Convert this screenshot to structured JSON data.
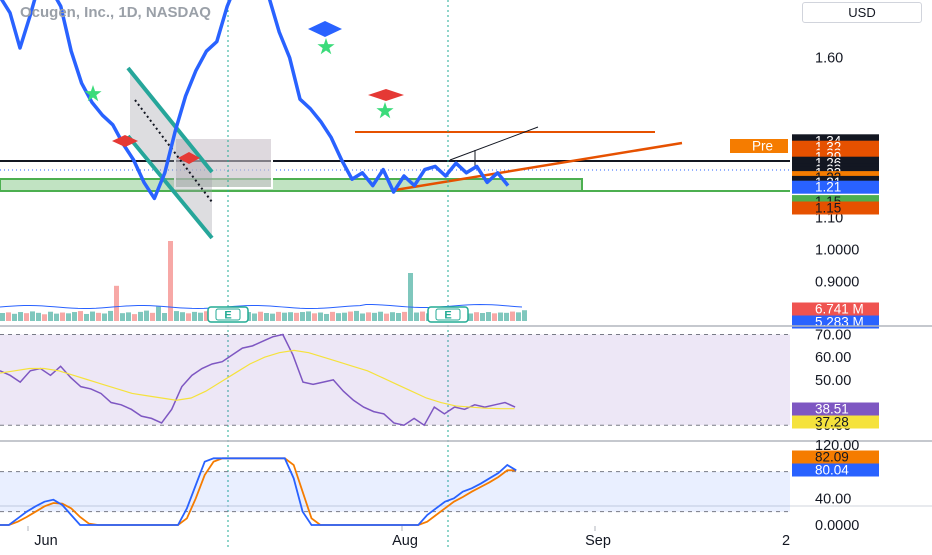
{
  "header": {
    "symbol_title": "Ocugen, Inc., 1D, NASDAQ",
    "currency_button": "USD"
  },
  "colors": {
    "price_line": "#2962ff",
    "rsi_line": "#7e57c2",
    "rsi_ma": "#f5e23c",
    "stoch_k": "#2962ff",
    "stoch_d": "#f57c00",
    "trend_orange": "#e65100",
    "channel_green": "#26a69a",
    "zone_green": "#4caf50",
    "earnings": "#22ab94"
  },
  "chart_data": [
    {
      "type": "line",
      "name": "price-pane",
      "title": "Ocugen, Inc., 1D, NASDAQ",
      "x_ticks": [
        "Jun",
        "Aug",
        "Sep",
        "2"
      ],
      "ylim": [
        0.78,
        1.78
      ],
      "y_tick_labels": [
        {
          "label": "1.60",
          "value": 1.6
        },
        {
          "label": "1.10",
          "value": 1.1
        },
        {
          "label": "1.0000",
          "value": 1.0
        },
        {
          "label": "0.9000",
          "value": 0.9
        }
      ],
      "series": [
        {
          "values": [
            1.8,
            1.74,
            1.63,
            1.73,
            1.84,
            1.82,
            1.76,
            1.62,
            1.52,
            1.46,
            1.42,
            1.39,
            1.33,
            1.28,
            1.21,
            1.16,
            1.24,
            1.37,
            1.48,
            1.56,
            1.62,
            1.65,
            1.76,
            1.84,
            1.86,
            1.84,
            1.79,
            1.68,
            1.6,
            1.47,
            1.44,
            1.4,
            1.35,
            1.28,
            1.22,
            1.24,
            1.2,
            1.25,
            1.18,
            1.23,
            1.2,
            1.25,
            1.26,
            1.23,
            1.27,
            1.24,
            1.26,
            1.21,
            1.24,
            1.2
          ]
        }
      ],
      "price_tags": [
        {
          "label": "1.34",
          "value": 1.34,
          "bg": "#131722",
          "fg": "#ffffff"
        },
        {
          "label": "1.32",
          "value": 1.32,
          "bg": "#e65100",
          "fg": "#ffffff"
        },
        {
          "label": "1.32",
          "value": 1.3,
          "bg": "#e65100",
          "fg": "#ffffff"
        },
        {
          "label": "1.29",
          "value": 1.29,
          "bg": "#e65100",
          "fg": "#ffffff"
        },
        {
          "label": "1.26",
          "value": 1.27,
          "bg": "#131722",
          "fg": "#ffffff"
        },
        {
          "label": "1.23",
          "value": 1.25,
          "bg": "#131722",
          "fg": "#ffffff"
        },
        {
          "label": "1.23",
          "value": 1.24,
          "bg": "#131722",
          "fg": "#ffffff"
        },
        {
          "label": "1.22",
          "value": 1.225,
          "bg": "#f57c00",
          "fg": "#131722"
        },
        {
          "label": "1.21",
          "value": 1.21,
          "bg": "#131722",
          "fg": "#ffffff"
        },
        {
          "label": "1.21",
          "value": 1.195,
          "bg": "#2962ff",
          "fg": "#ffffff"
        },
        {
          "label": "1.15",
          "value": 1.15,
          "bg": "#4caf50",
          "fg": "#131722"
        },
        {
          "label": "1.15",
          "value": 1.13,
          "bg": "#e65100",
          "fg": "#131722"
        }
      ],
      "pre_market_label": "Pre",
      "volume_tags": [
        {
          "label": "6.741 M",
          "bg": "#ef5350"
        },
        {
          "label": "5.283 M",
          "bg": "#2962ff"
        }
      ],
      "volume": [
        5.0,
        5.4,
        4.5,
        5.6,
        4.9,
        6.0,
        5.1,
        4.2,
        5.8,
        4.6,
        5.3,
        4.8,
        5.6,
        6.2,
        4.4,
        5.9,
        5.1,
        4.7,
        6.3,
        22.0,
        4.9,
        5.4,
        4.3,
        5.7,
        6.5,
        5.1,
        9.0,
        5.0,
        50.0,
        6.2,
        5.5,
        4.8,
        5.7,
        5.2,
        6.1,
        4.6,
        5.3,
        5.9,
        4.9,
        5.4,
        4.5,
        5.6,
        4.7,
        5.8,
        5.0,
        4.6,
        5.7,
        5.2,
        5.5,
        5.1,
        5.6,
        6.0,
        4.8,
        5.3,
        4.4,
        5.7,
        4.9,
        5.2,
        5.9,
        6.3,
        4.7,
        5.4,
        5.1,
        5.8,
        4.6,
        5.5,
        5.0,
        5.7,
        30.0,
        5.3,
        5.9,
        4.8,
        5.6,
        5.1,
        5.4,
        4.9,
        5.8,
        5.2,
        4.7,
        5.5,
        5.0,
        5.6,
        4.8,
        5.3,
        5.1,
        5.9,
        5.4,
        6.741
      ]
    },
    {
      "type": "line",
      "name": "rsi-pane",
      "ylim": [
        27,
        72
      ],
      "y_tick_labels": [
        {
          "label": "70.00",
          "value": 70
        },
        {
          "label": "60.00",
          "value": 60
        },
        {
          "label": "50.00",
          "value": 50
        },
        {
          "label": "30.00",
          "value": 30
        }
      ],
      "band": [
        30,
        70
      ],
      "series": [
        {
          "name": "RSI",
          "color": "#7e57c2",
          "values": [
            54,
            52,
            49,
            54,
            55,
            52,
            56,
            51,
            47,
            46,
            44,
            40,
            39,
            37,
            34,
            33,
            31,
            37,
            47,
            52,
            55,
            57,
            58,
            61,
            64,
            65,
            67,
            69,
            70,
            61,
            49,
            48,
            49,
            50,
            45,
            41,
            38,
            36,
            35,
            31,
            30,
            33,
            30,
            38,
            35,
            38,
            37,
            39,
            38,
            39,
            40,
            38
          ]
        },
        {
          "name": "RSI MA",
          "color": "#f5e23c",
          "values": [
            53,
            54,
            55,
            55,
            54,
            52,
            50,
            48,
            46,
            44,
            43,
            42,
            41,
            42,
            45,
            49,
            53,
            57,
            60,
            62,
            63,
            62,
            60,
            58,
            56,
            54,
            51,
            48,
            45,
            42,
            40,
            38.5,
            38,
            37.5,
            37.3,
            37.28
          ]
        }
      ],
      "value_tags": [
        {
          "label": "38.51",
          "bg": "#7e57c2",
          "fg": "#ffffff"
        },
        {
          "label": "37.28",
          "bg": "#f5e23c",
          "fg": "#131722"
        }
      ]
    },
    {
      "type": "line",
      "name": "stoch-pane",
      "ylim": [
        0,
        120
      ],
      "y_tick_labels": [
        {
          "label": "120.00",
          "value": 120
        },
        {
          "label": "40.00",
          "value": 40
        },
        {
          "label": "0.0000",
          "value": 0
        }
      ],
      "band": [
        20,
        80
      ],
      "series": [
        {
          "name": "K",
          "color": "#2962ff",
          "values": [
            0,
            0,
            10,
            20,
            28,
            35,
            38,
            30,
            15,
            0,
            0,
            0,
            0,
            0,
            0,
            0,
            0,
            0,
            0,
            0,
            0,
            25,
            60,
            95,
            100,
            100,
            100,
            100,
            100,
            100,
            100,
            100,
            100,
            70,
            20,
            0,
            0,
            0,
            0,
            0,
            0,
            0,
            0,
            0,
            0,
            0,
            0,
            0,
            15,
            25,
            35,
            40,
            50,
            55,
            62,
            70,
            78,
            90,
            82
          ]
        },
        {
          "name": "D",
          "color": "#f57c00",
          "values": [
            0,
            0,
            5,
            12,
            20,
            28,
            33,
            32,
            25,
            12,
            2,
            0,
            0,
            0,
            0,
            0,
            0,
            0,
            0,
            0,
            0,
            10,
            40,
            75,
            95,
            100,
            100,
            100,
            100,
            100,
            100,
            100,
            100,
            90,
            50,
            10,
            0,
            0,
            0,
            0,
            0,
            0,
            0,
            0,
            0,
            0,
            0,
            0,
            5,
            15,
            25,
            35,
            42,
            50,
            57,
            64,
            72,
            82,
            82
          ]
        }
      ],
      "value_tags": [
        {
          "label": "82.09",
          "bg": "#f57c00",
          "fg": "#131722"
        },
        {
          "label": "80.04",
          "bg": "#2962ff",
          "fg": "#ffffff"
        }
      ]
    }
  ]
}
